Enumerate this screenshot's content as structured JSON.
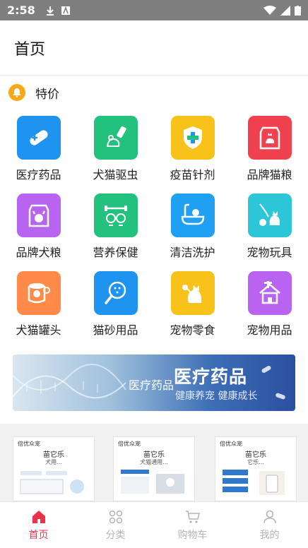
{
  "status_bar": {
    "time": "2:58"
  },
  "header": {
    "title": "首页"
  },
  "section": {
    "label": "特价",
    "icon": "bell-icon"
  },
  "categories": [
    {
      "label": "医疗药品",
      "icon": "pill-icon",
      "color": "#1f93f0"
    },
    {
      "label": "犬猫驱虫",
      "icon": "bug-spray-icon",
      "color": "#22c17d"
    },
    {
      "label": "疫苗针剂",
      "icon": "vaccine-shield-icon",
      "color": "#f8c21b"
    },
    {
      "label": "品牌猫粮",
      "icon": "cat-food-icon",
      "color": "#f0414f"
    },
    {
      "label": "品牌犬粮",
      "icon": "dog-food-icon",
      "color": "#b964f0"
    },
    {
      "label": "营养保健",
      "icon": "dumbbell-dogs-icon",
      "color": "#22c17d"
    },
    {
      "label": "清洁洗护",
      "icon": "bathtub-icon",
      "color": "#1fa0f2"
    },
    {
      "label": "宠物玩具",
      "icon": "cat-toy-icon",
      "color": "#2cc6d8"
    },
    {
      "label": "犬猫罐头",
      "icon": "can-icon",
      "color": "#ff8a4a"
    },
    {
      "label": "猫砂用品",
      "icon": "litter-scoop-icon",
      "color": "#1f93f0"
    },
    {
      "label": "宠物零食",
      "icon": "cat-treat-icon",
      "color": "#f8c21b"
    },
    {
      "label": "宠物用品",
      "icon": "cat-tree-icon",
      "color": "#b964f0"
    }
  ],
  "banner": {
    "subtitle": "医疗药品",
    "title": "医疗药品",
    "slogan": "健康养宠 健康成长"
  },
  "products": [
    {
      "brand": "倍优众宠",
      "name": "苗它乐",
      "desc": "犬用...",
      "badge_color": "#1fb35e"
    },
    {
      "brand": "倍优众宠",
      "name": "苗它乐",
      "desc": "犬猫通用...",
      "badge_color": "#1fb35e"
    },
    {
      "brand": "倍优众宠",
      "name": "苗它乐",
      "desc": "它乐...",
      "badge_color": "#1fb35e"
    }
  ],
  "tabs": [
    {
      "label": "首页",
      "icon": "home-icon",
      "active": true
    },
    {
      "label": "分类",
      "icon": "grid-icon",
      "active": false
    },
    {
      "label": "购物车",
      "icon": "cart-icon",
      "active": false
    },
    {
      "label": "我的",
      "icon": "user-icon",
      "active": false
    }
  ],
  "colors": {
    "accent": "#e8334a",
    "inactive": "#b5b5b5",
    "status_bar": "#7f7f7f"
  }
}
